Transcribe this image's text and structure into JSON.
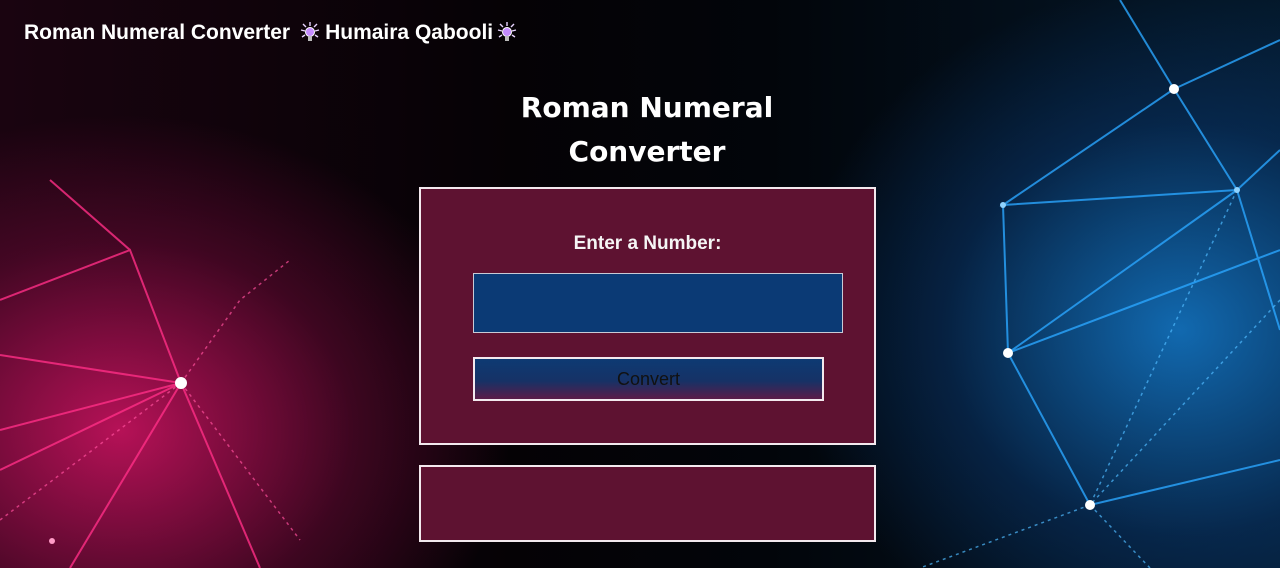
{
  "header": {
    "title": "Roman Numeral Converter",
    "author": "Humaira Qabooli",
    "icon": "sparkle-bulb-icon"
  },
  "main": {
    "title_line1": "Roman Numeral",
    "title_line2": "Converter"
  },
  "form": {
    "label": "Enter a Number:",
    "input_value": "",
    "convert_label": "Convert"
  },
  "result": {
    "text": ""
  },
  "colors": {
    "card_bg": "#5e1231",
    "input_bg": "#0b3a75",
    "border": "#f3e9ee"
  }
}
